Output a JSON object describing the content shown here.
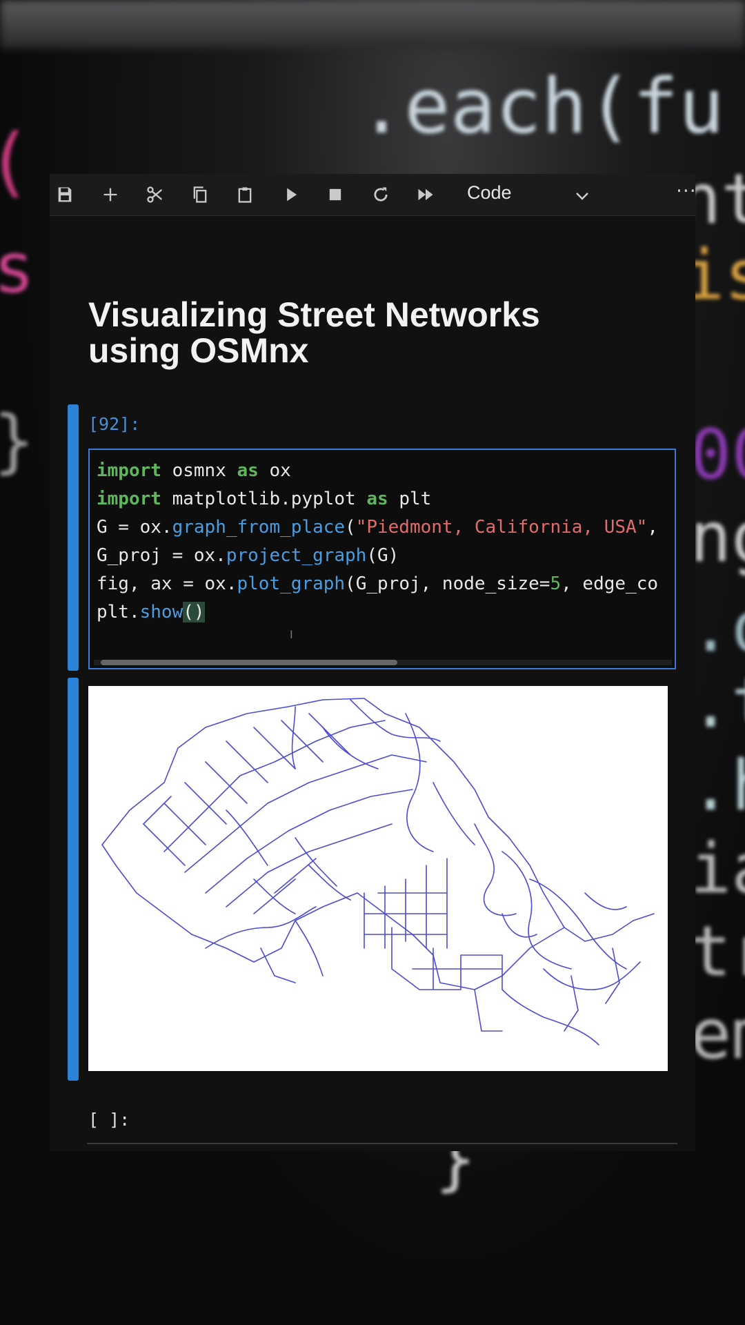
{
  "toolbar": {
    "icons": [
      "save-icon",
      "add-icon",
      "cut-icon",
      "copy-icon",
      "paste-icon",
      "run-icon",
      "stop-icon",
      "restart-icon",
      "run-all-icon"
    ],
    "cell_type": "Code",
    "more": "···"
  },
  "notebook": {
    "title": "Visualizing Street Networks using OSMnx",
    "cell1": {
      "prompt": "[92]:",
      "code": [
        "import osmnx as ox",
        "import matplotlib.pyplot as plt",
        "G = ox.graph_from_place(\"Piedmont, California, USA\",",
        "G_proj = ox.project_graph(G)",
        "fig, ax = ox.plot_graph(G_proj, node_size=5, edge_co",
        "plt.show()"
      ]
    },
    "output": {
      "figure": "street network plot of Piedmont, California",
      "edge_color": "#4b4bd6",
      "background": "#ffffff"
    },
    "cell2": {
      "prompt": "[ ]:"
    }
  },
  "colors": {
    "accent": "#2a82d9",
    "keyword": "#5fb65f",
    "function": "#4a9de0",
    "string": "#e06c6c",
    "prompt": "#4a8fd6"
  }
}
